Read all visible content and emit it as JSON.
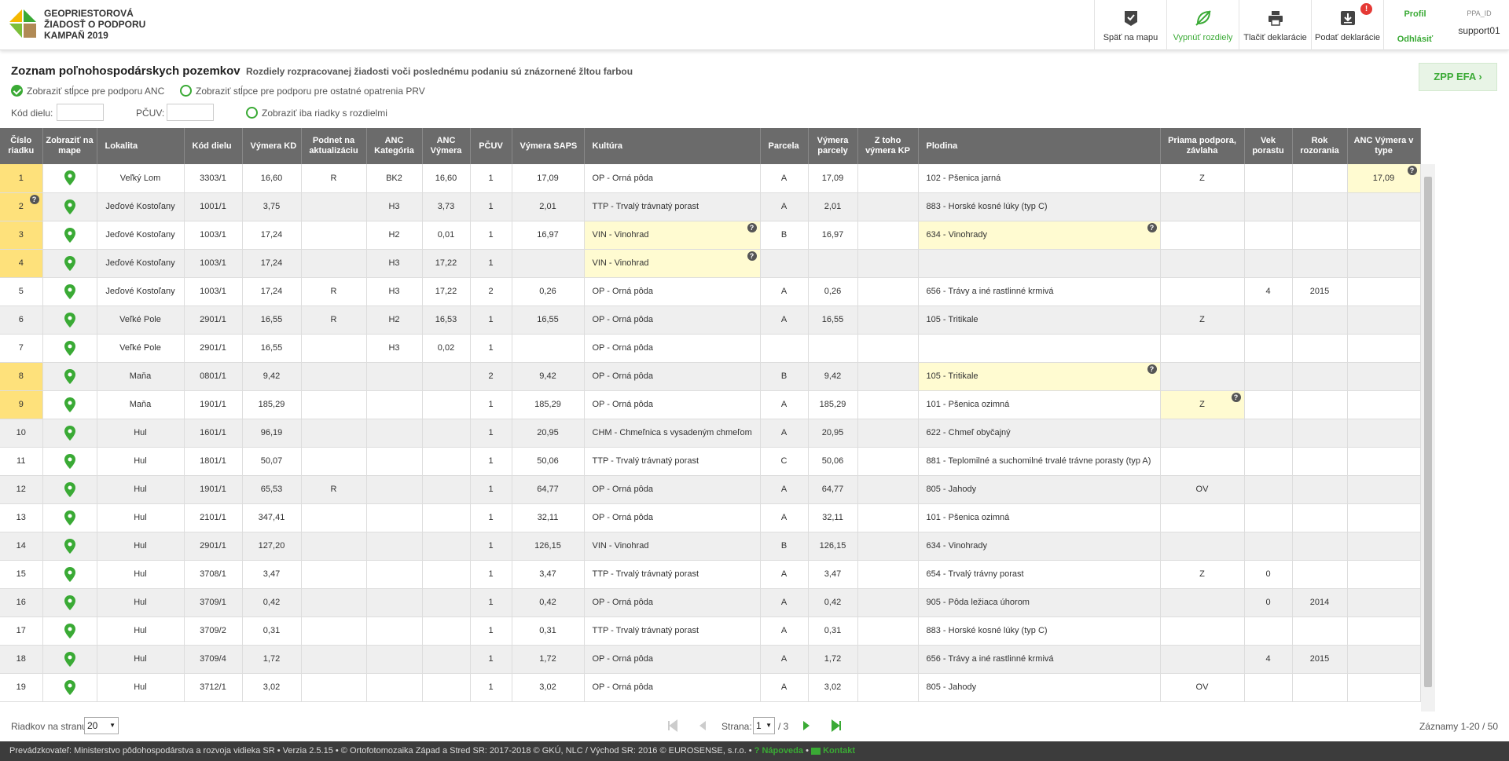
{
  "app": {
    "title_line1": "GEOPRIESTOROVÁ",
    "title_line2": "ŽIADOSŤ O PODPORU",
    "title_line3": "KAMPAŇ 2019"
  },
  "header": {
    "map_label": "Späť na mapu",
    "diff_label": "Vypnúť rozdiely",
    "print_label": "Tlačiť deklarácie",
    "submit_label": "Podať deklarácie",
    "submit_badge": "!",
    "profile_label": "Profil",
    "logout_label": "Odhlásiť",
    "ppa_label": "PPA_ID",
    "user_id": "support01"
  },
  "page": {
    "title": "Zoznam poľnohospodárskych pozemkov",
    "subtitle": "Rozdiely rozpracovanej žiadosti voči poslednému podaniu sú znázornené žltou farbou",
    "opt_anc": "Zobraziť stĺpce pre podporu ANC",
    "opt_prv": "Zobraziť stĺpce pre podporu pre ostatné opatrenia PRV",
    "filter_kod_label": "Kód dielu:",
    "filter_kod_value": "",
    "filter_pcuv_label": "PČUV:",
    "filter_pcuv_value": "",
    "opt_diff_only": "Zobraziť iba riadky s rozdielmi",
    "zpp_button": "ZPP EFA"
  },
  "table": {
    "columns": [
      "Číslo riadku",
      "Zobraziť na mape",
      "Lokalita",
      "Kód dielu",
      "Výmera KD",
      "Podnet na aktualizáciu",
      "ANC Kategória",
      "ANC Výmera",
      "PČUV",
      "Výmera SAPS",
      "Kultúra",
      "Parcela",
      "Výmera parcely",
      "Z toho výmera KP",
      "Plodina",
      "Priama podpora, závlaha",
      "Vek porastu",
      "Rok rozorania",
      "ANC Výmera v type"
    ],
    "rows": [
      [
        "1",
        "",
        "Veľký Lom",
        "3303/1",
        "16,60",
        "R",
        "BK2",
        "16,60",
        "1",
        "17,09",
        "OP - Orná pôda",
        "A",
        "17,09",
        "",
        "102 - Pšenica jarná",
        "Z",
        "",
        "",
        "17,09"
      ],
      [
        "2",
        "",
        "Jeďové Kostoľany",
        "1001/1",
        "3,75",
        "",
        "H3",
        "3,73",
        "1",
        "2,01",
        "TTP - Trvalý trávnatý porast",
        "A",
        "2,01",
        "",
        "883 - Horské kosné lúky (typ C)",
        "",
        "",
        "",
        ""
      ],
      [
        "3",
        "",
        "Jeďové Kostoľany",
        "1003/1",
        "17,24",
        "",
        "H2",
        "0,01",
        "1",
        "16,97",
        "VIN - Vinohrad",
        "B",
        "16,97",
        "",
        "634 - Vinohrady",
        "",
        "",
        "",
        ""
      ],
      [
        "4",
        "",
        "Jeďové Kostoľany",
        "1003/1",
        "17,24",
        "",
        "H3",
        "17,22",
        "1",
        "",
        "VIN - Vinohrad",
        "",
        "",
        "",
        "",
        "",
        "",
        "",
        ""
      ],
      [
        "5",
        "",
        "Jeďové Kostoľany",
        "1003/1",
        "17,24",
        "R",
        "H3",
        "17,22",
        "2",
        "0,26",
        "OP - Orná pôda",
        "A",
        "0,26",
        "",
        "656 - Trávy a iné rastlinné krmivá",
        "",
        "4",
        "2015",
        ""
      ],
      [
        "6",
        "",
        "Veľké Pole",
        "2901/1",
        "16,55",
        "R",
        "H2",
        "16,53",
        "1",
        "16,55",
        "OP - Orná pôda",
        "A",
        "16,55",
        "",
        "105 - Tritikale",
        "Z",
        "",
        "",
        ""
      ],
      [
        "7",
        "",
        "Veľké Pole",
        "2901/1",
        "16,55",
        "",
        "H3",
        "0,02",
        "1",
        "",
        "OP - Orná pôda",
        "",
        "",
        "",
        "",
        "",
        "",
        "",
        ""
      ],
      [
        "8",
        "",
        "Maňa",
        "0801/1",
        "9,42",
        "",
        "",
        "",
        "2",
        "9,42",
        "OP - Orná pôda",
        "B",
        "9,42",
        "",
        "105 - Tritikale",
        "",
        "",
        "",
        ""
      ],
      [
        "9",
        "",
        "Maňa",
        "1901/1",
        "185,29",
        "",
        "",
        "",
        "1",
        "185,29",
        "OP - Orná pôda",
        "A",
        "185,29",
        "",
        "101 - Pšenica ozimná",
        "Z",
        "",
        "",
        ""
      ],
      [
        "10",
        "",
        "Hul",
        "1601/1",
        "96,19",
        "",
        "",
        "",
        "1",
        "20,95",
        "CHM - Chmeľnica s vysadeným chmeľom",
        "A",
        "20,95",
        "",
        "622 - Chmeľ obyčajný",
        "",
        "",
        "",
        ""
      ],
      [
        "11",
        "",
        "Hul",
        "1801/1",
        "50,07",
        "",
        "",
        "",
        "1",
        "50,06",
        "TTP - Trvalý trávnatý porast",
        "C",
        "50,06",
        "",
        "881 - Teplomilné a suchomilné trvalé trávne porasty (typ A)",
        "",
        "",
        "",
        ""
      ],
      [
        "12",
        "",
        "Hul",
        "1901/1",
        "65,53",
        "R",
        "",
        "",
        "1",
        "64,77",
        "OP - Orná pôda",
        "A",
        "64,77",
        "",
        "805 - Jahody",
        "OV",
        "",
        "",
        ""
      ],
      [
        "13",
        "",
        "Hul",
        "2101/1",
        "347,41",
        "",
        "",
        "",
        "1",
        "32,11",
        "OP - Orná pôda",
        "A",
        "32,11",
        "",
        "101 - Pšenica ozimná",
        "",
        "",
        "",
        ""
      ],
      [
        "14",
        "",
        "Hul",
        "2901/1",
        "127,20",
        "",
        "",
        "",
        "1",
        "126,15",
        "VIN - Vinohrad",
        "B",
        "126,15",
        "",
        "634 - Vinohrady",
        "",
        "",
        "",
        ""
      ],
      [
        "15",
        "",
        "Hul",
        "3708/1",
        "3,47",
        "",
        "",
        "",
        "1",
        "3,47",
        "TTP - Trvalý trávnatý porast",
        "A",
        "3,47",
        "",
        "654 - Trvalý trávny porast",
        "Z",
        "0",
        "",
        ""
      ],
      [
        "16",
        "",
        "Hul",
        "3709/1",
        "0,42",
        "",
        "",
        "",
        "1",
        "0,42",
        "OP - Orná pôda",
        "A",
        "0,42",
        "",
        "905 - Pôda ležiaca úhorom",
        "",
        "0",
        "2014",
        ""
      ],
      [
        "17",
        "",
        "Hul",
        "3709/2",
        "0,31",
        "",
        "",
        "",
        "1",
        "0,31",
        "TTP - Trvalý trávnatý porast",
        "A",
        "0,31",
        "",
        "883 - Horské kosné lúky (typ C)",
        "",
        "",
        "",
        ""
      ],
      [
        "18",
        "",
        "Hul",
        "3709/4",
        "1,72",
        "",
        "",
        "",
        "1",
        "1,72",
        "OP - Orná pôda",
        "A",
        "1,72",
        "",
        "656 - Trávy a iné rastlinné krmivá",
        "",
        "4",
        "2015",
        ""
      ],
      [
        "19",
        "",
        "Hul",
        "3712/1",
        "3,02",
        "",
        "",
        "",
        "1",
        "3,02",
        "OP - Orná pôda",
        "A",
        "3,02",
        "",
        "805 - Jahody",
        "OV",
        "",
        "",
        ""
      ]
    ],
    "highlights": {
      "rownum": [
        0,
        1,
        2,
        3,
        7,
        8
      ],
      "cells": [
        [
          0,
          18
        ],
        [
          2,
          10
        ],
        [
          2,
          14
        ],
        [
          3,
          10
        ],
        [
          7,
          14
        ],
        [
          8,
          15
        ]
      ],
      "help": [
        [
          1,
          0
        ],
        [
          2,
          10
        ],
        [
          2,
          14
        ],
        [
          3,
          10
        ],
        [
          7,
          14
        ],
        [
          8,
          15
        ],
        [
          0,
          18
        ]
      ]
    }
  },
  "pager": {
    "per_page_label": "Riadkov na stranu",
    "per_page_value": "20",
    "page_label": "Strana:",
    "page_value": "1",
    "page_total": "/ 3",
    "records": "Záznamy 1-20 / 50"
  },
  "footer": {
    "text": "Prevádzkovateľ: Ministerstvo pôdohospodárstva a rozvoja vidieka SR • Verzia 2.5.15 • © Ortofotomozaika Západ a Stred SR: 2017-2018 © GKÚ, NLC / Východ SR: 2016 © EUROSENSE, s.r.o. •",
    "help_label": "Nápoveda",
    "contact_label": "Kontakt"
  },
  "colors": {
    "accent": "#3aaa35",
    "diff_yellow": "#fffbd1",
    "rownum_yellow": "#fee17b",
    "header_gray": "#6b6b6b"
  }
}
